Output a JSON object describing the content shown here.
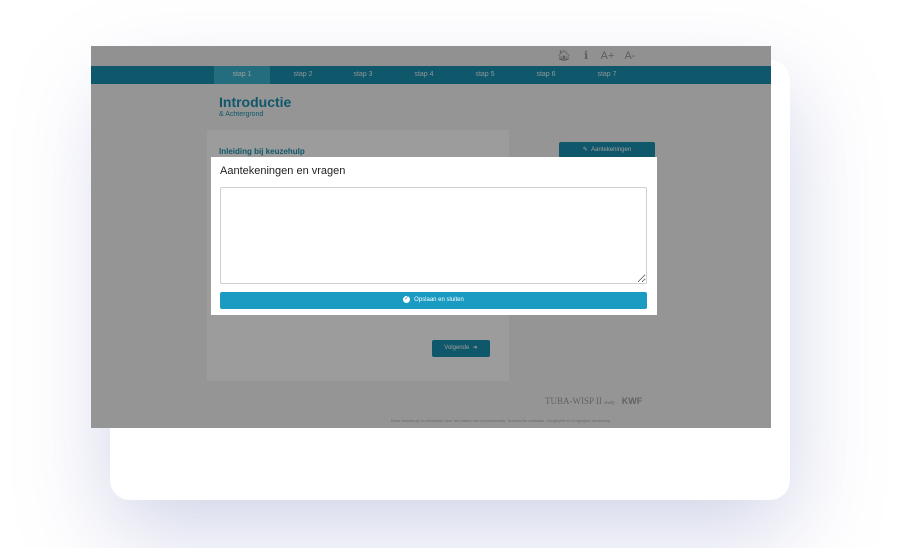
{
  "topbar": {
    "home_icon": "home-icon",
    "info_icon": "info-icon",
    "font_increase": "A+",
    "font_decrease": "A-"
  },
  "nav": {
    "tabs": [
      "stap 1",
      "stap 2",
      "stap 3",
      "stap 4",
      "stap 5",
      "stap 6",
      "stap 7"
    ],
    "active_index": 0
  },
  "page": {
    "title": "Introductie",
    "subtitle": "& Achtergrond",
    "section_title": "Inleiding bij keuzehulp",
    "notes_button": "Aantekeningen",
    "next_button": "Volgende",
    "logo_tuba": "TUBA-WISP II",
    "logo_study": "study",
    "logo_kwf": "KWF",
    "footer": "Deze keuzehulp is ontwikkeld door het Antoni van Leeuwenhoek. Technische realisatie: Zorgtoolkit en Zorgwijzer Keuzehulp."
  },
  "modal": {
    "title": "Aantekeningen en vragen",
    "textarea_value": "",
    "save_button": "Opslaan en sluiten"
  },
  "colors": {
    "accent": "#1a8fae",
    "active_tab": "#3ab2d0",
    "save_button": "#1a9bc2",
    "overlay": "rgba(0,0,0,0.39)"
  }
}
